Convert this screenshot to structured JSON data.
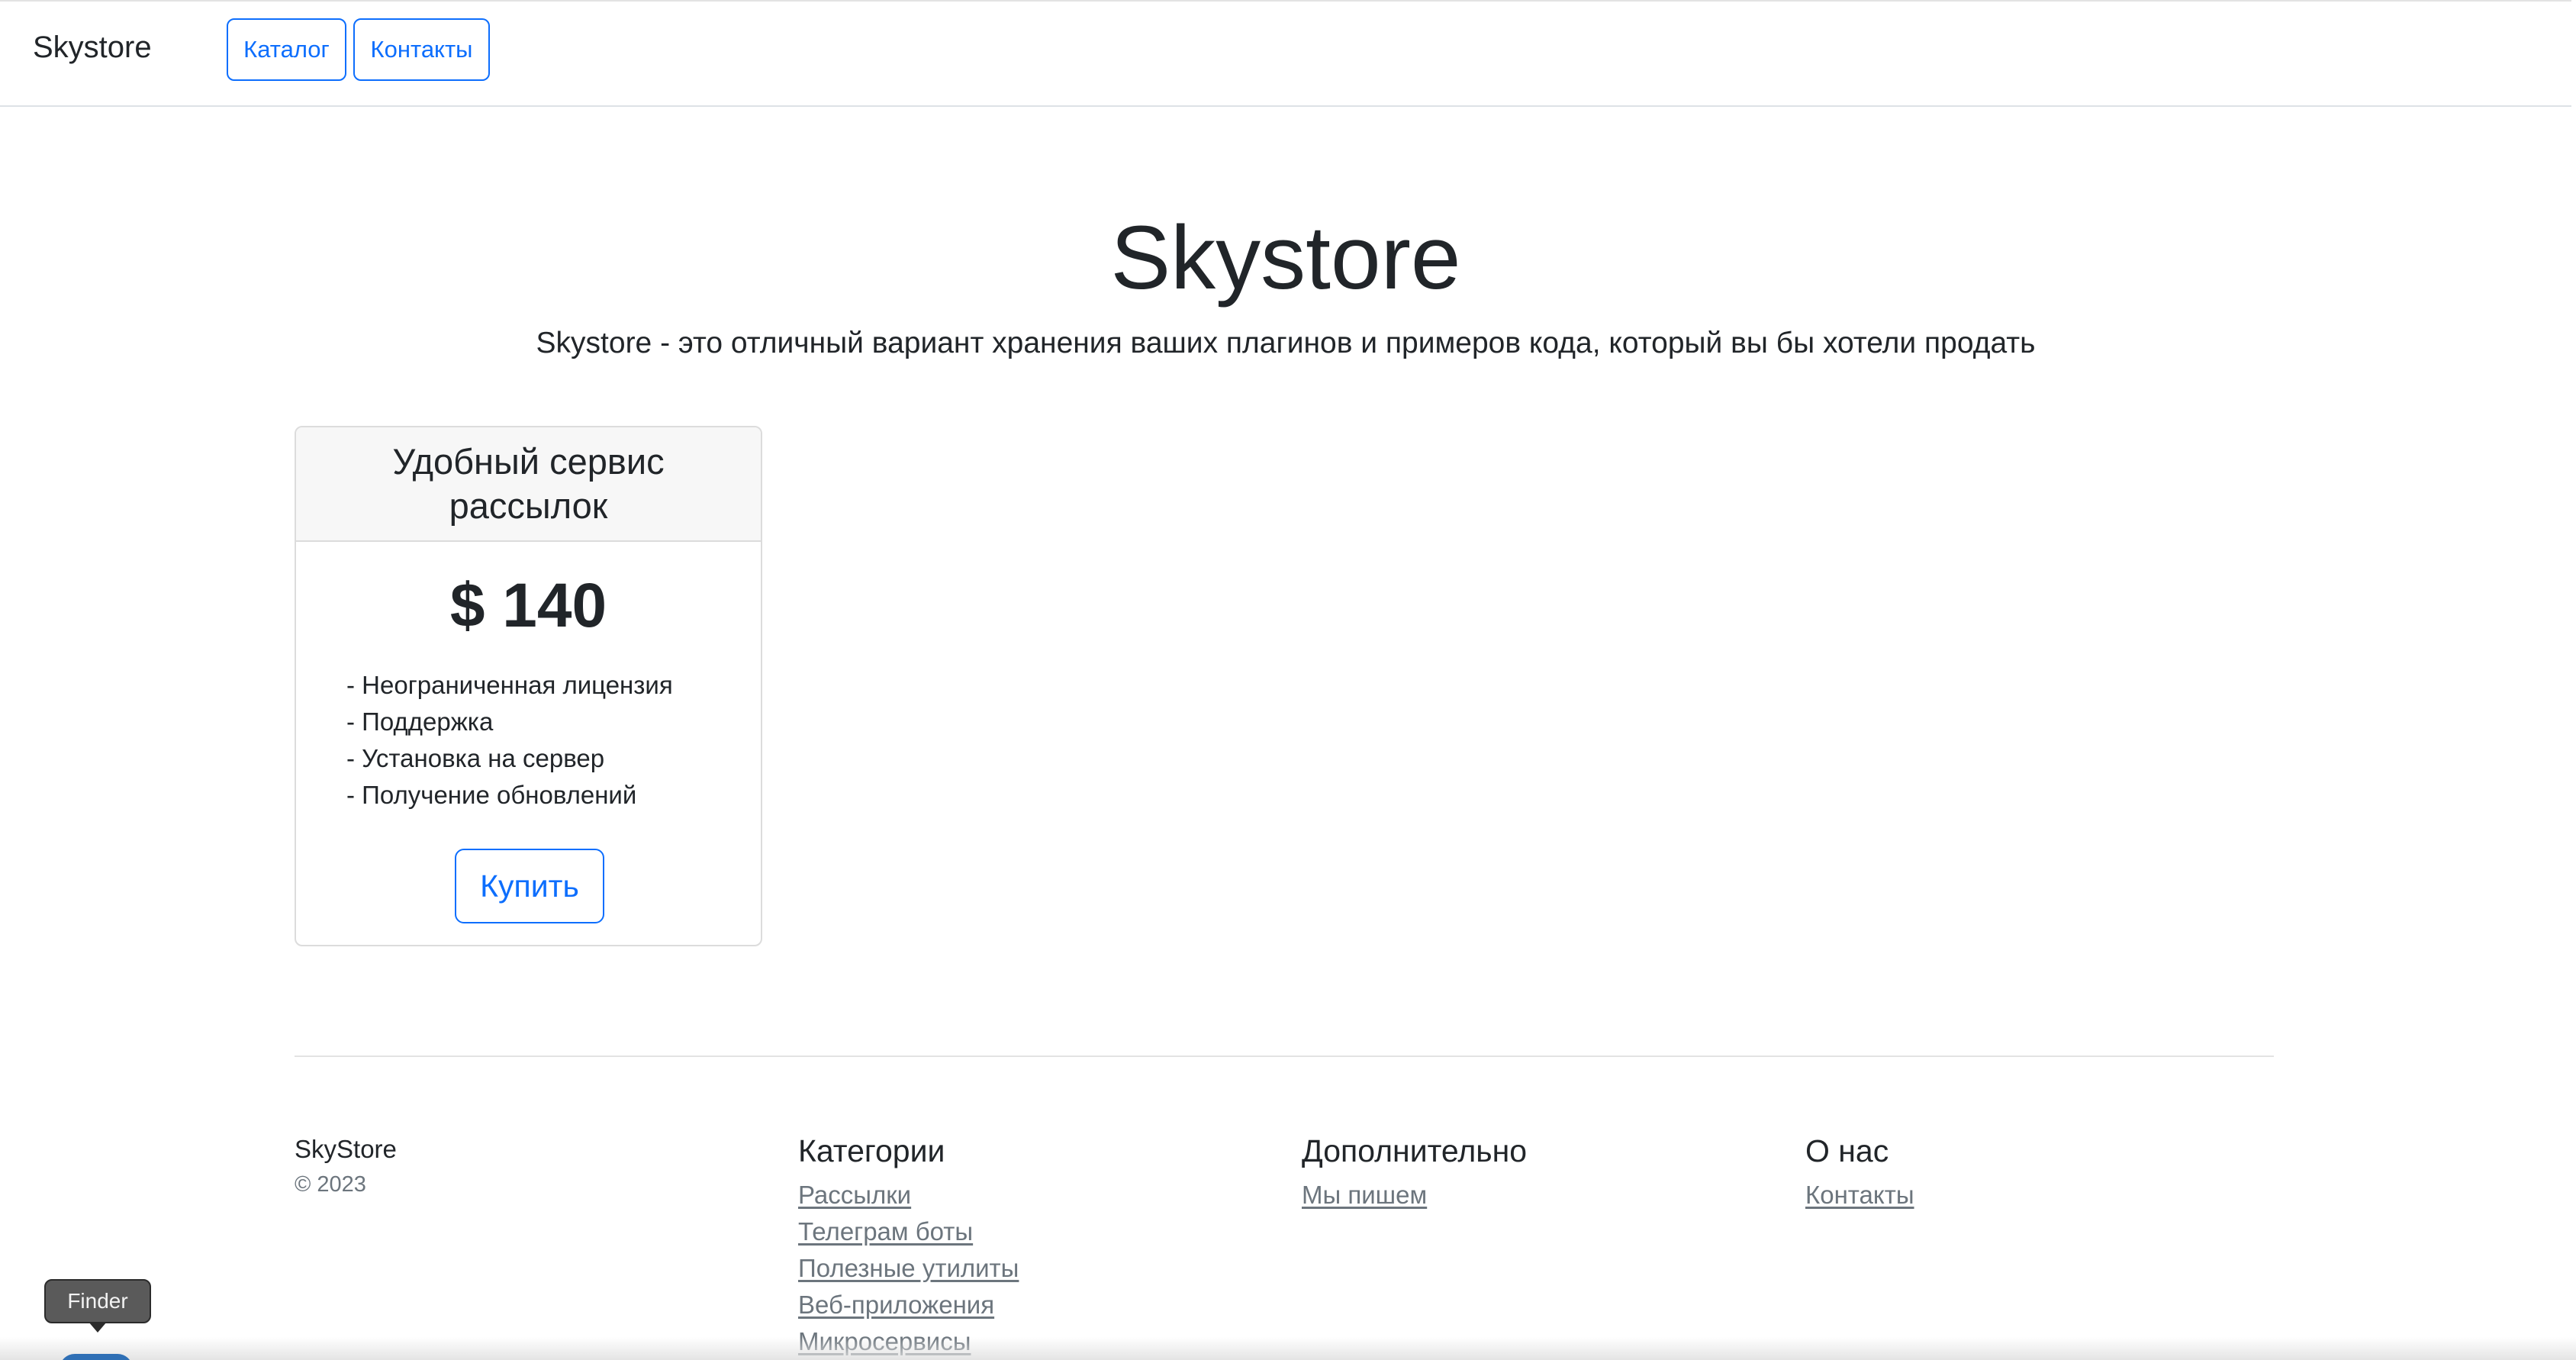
{
  "header": {
    "brand": "Skystore",
    "nav": [
      {
        "label": "Каталог"
      },
      {
        "label": "Контакты"
      }
    ]
  },
  "hero": {
    "title": "Skystore",
    "lead": "Skystore - это отличный вариант хранения ваших плагинов и примеров кода, который вы бы хотели продать"
  },
  "product": {
    "title": "Удобный сервис рассылок",
    "price": "$ 140",
    "features": [
      "- Неограниченная лицензия",
      "- Поддержка",
      "- Установка на сервер",
      "- Получение обновлений"
    ],
    "buy_label": "Купить"
  },
  "footer": {
    "brand": "SkyStore",
    "copyright": "© 2023",
    "columns": [
      {
        "heading": "Категории",
        "links": [
          "Рассылки",
          "Телеграм боты",
          "Полезные утилиты",
          "Веб-приложения",
          "Микросервисы"
        ]
      },
      {
        "heading": "Дополнительно",
        "links": [
          "Мы пишем"
        ]
      },
      {
        "heading": "О нас",
        "links": [
          "Контакты"
        ]
      }
    ]
  },
  "dock": {
    "tooltip": "Finder"
  },
  "colors": {
    "accent": "#0d6efd",
    "text": "#212529",
    "muted": "#6c757d",
    "card_header_bg": "#f7f7f7"
  }
}
